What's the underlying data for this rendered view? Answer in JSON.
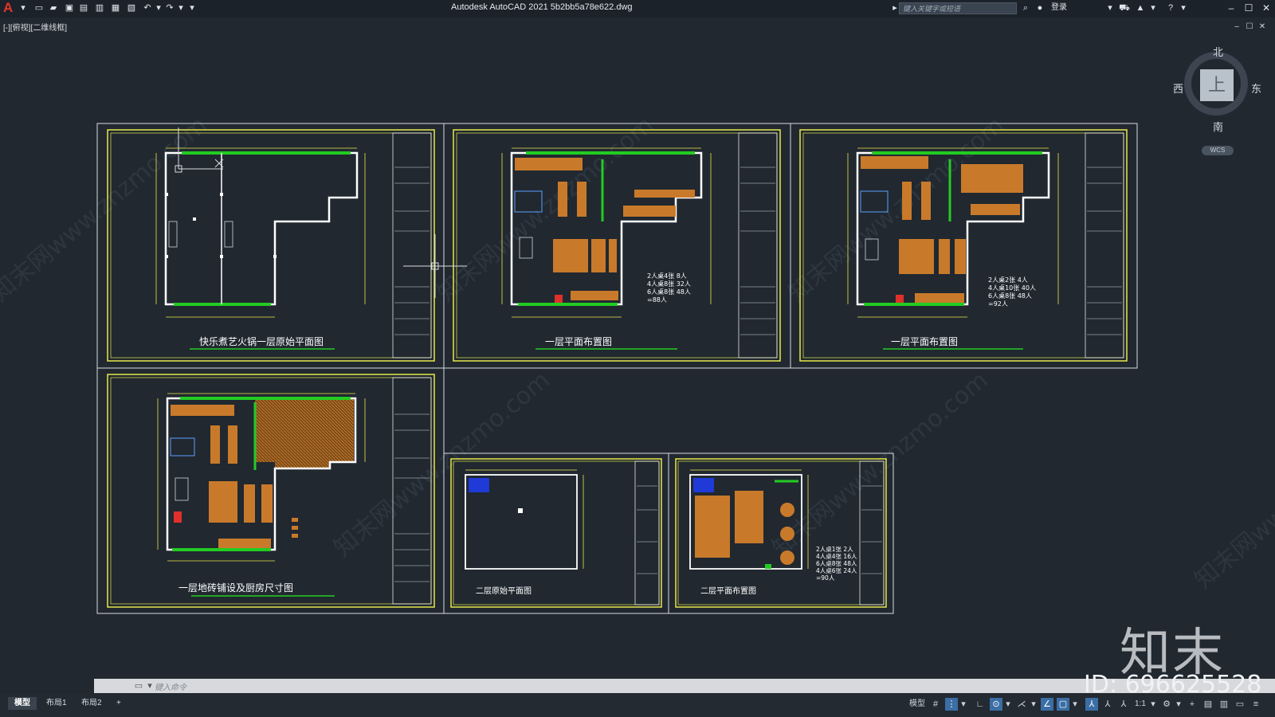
{
  "window": {
    "app_logo": "A",
    "title": "Autodesk AutoCAD 2021     5b2bb5a78e622.dwg",
    "search_placeholder": "键入关键字或短语",
    "login_label": "登录",
    "minimize": "–",
    "maximize": "☐",
    "close": "✕"
  },
  "viewport": {
    "label": "[-][俯视][二维线框]",
    "restore": "☐",
    "close": "✕",
    "min": "–"
  },
  "viewcube": {
    "north": "北",
    "south": "南",
    "east": "东",
    "west": "西",
    "face": "上",
    "wcs": "WCS"
  },
  "sheets": {
    "s1_title": "快乐煮艺火锅一层原始平面图",
    "s2_title": "一层平面布置图",
    "s3_title": "一层平面布置图",
    "s4_title": "一层地砖铺设及厨房尺寸图",
    "s5_title": "二层原始平面图",
    "s6_title": "二层平面布置图"
  },
  "seat_tables": {
    "s2": [
      "2人桌4张  8人",
      "4人桌8张  32人",
      "6人桌8张  48人",
      "=88人"
    ],
    "s3": [
      "2人桌2张   4人",
      "4人桌10张  40人",
      "6人桌8张  48人",
      "=92人"
    ],
    "s6": [
      "2人桌1张   2人",
      "4人桌4张  16人",
      "6人桌8张  48人",
      "4人桌6张  24人",
      "=90人"
    ]
  },
  "command": {
    "placeholder": "键入命令"
  },
  "layout_tabs": [
    "模型",
    "布局1",
    "布局2",
    "+"
  ],
  "status": {
    "model": "模型",
    "scale": "1:1"
  },
  "watermark": {
    "logo": "知末",
    "id": "ID: 696625528",
    "diag": "知末网www.znzmo.com"
  },
  "colors": {
    "background": "#212830",
    "frame": "#e8e84a",
    "wall": "#ffffff",
    "green": "#22cc22",
    "furniture": "#c87a2a",
    "accent_red": "#e0302a"
  }
}
